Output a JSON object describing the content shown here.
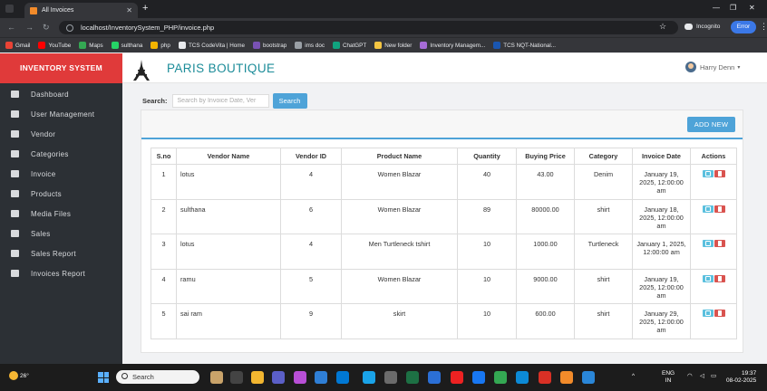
{
  "browser": {
    "tab_title": "All Invoices",
    "url": "localhost/InventorySystem_PHP/invoice.php",
    "incognito_label": "Incognito",
    "error_label": "Error",
    "bookmarks": [
      {
        "label": "Gmail",
        "color": "#ea4335"
      },
      {
        "label": "YouTube",
        "color": "#ff0000"
      },
      {
        "label": "Maps",
        "color": "#34a853"
      },
      {
        "label": "sulthana",
        "color": "#25d366"
      },
      {
        "label": "php",
        "color": "#f4b400"
      },
      {
        "label": "TCS CodeVita | Home",
        "color": "#e8eaed"
      },
      {
        "label": "bootstrap",
        "color": "#7952b3"
      },
      {
        "label": "ims doc",
        "color": "#9aa0a6"
      },
      {
        "label": "ChatGPT",
        "color": "#10a37f"
      },
      {
        "label": "New folder",
        "color": "#f4c542"
      },
      {
        "label": "Inventory Managem...",
        "color": "#a66cd6"
      },
      {
        "label": "TCS NQT-National...",
        "color": "#1a56b0"
      }
    ]
  },
  "sidebar": {
    "brand": "INVENTORY SYSTEM",
    "items": [
      {
        "label": "Dashboard",
        "icon": "home-icon"
      },
      {
        "label": "User Management",
        "icon": "user-icon"
      },
      {
        "label": "Vendor",
        "icon": "truck-icon"
      },
      {
        "label": "Categories",
        "icon": "list-icon"
      },
      {
        "label": "Invoice",
        "icon": "cart-icon"
      },
      {
        "label": "Products",
        "icon": "grid-icon"
      },
      {
        "label": "Media Files",
        "icon": "image-icon"
      },
      {
        "label": "Sales",
        "icon": "stack-icon"
      },
      {
        "label": "Sales Report",
        "icon": "chart-icon"
      },
      {
        "label": "Invoices Report",
        "icon": "report-icon"
      }
    ]
  },
  "header": {
    "store_name": "PARIS BOUTIQUE",
    "user_name": "Harry Denn"
  },
  "search": {
    "label": "Search:",
    "placeholder": "Search by Invoice Date, Ver",
    "button": "Search"
  },
  "panel": {
    "add_new": "ADD NEW"
  },
  "table": {
    "columns": [
      "S.no",
      "Vendor Name",
      "Vendor ID",
      "Product Name",
      "Quantity",
      "Buying Price",
      "Category",
      "Invoice Date",
      "Actions"
    ],
    "rows": [
      {
        "sno": "1",
        "vendor": "lotus",
        "vendor_id": "4",
        "product": "Women Blazar",
        "qty": "40",
        "price": "43.00",
        "category": "Denim",
        "date": "January 19, 2025, 12:00:00 am"
      },
      {
        "sno": "2",
        "vendor": "sulthana",
        "vendor_id": "6",
        "product": "Women Blazar",
        "qty": "89",
        "price": "80000.00",
        "category": "shirt",
        "date": "January 18, 2025, 12:00:00 am"
      },
      {
        "sno": "3",
        "vendor": "lotus",
        "vendor_id": "4",
        "product": "Men Turtleneck tshirt",
        "qty": "10",
        "price": "1000.00",
        "category": "Turtleneck",
        "date": "January 1, 2025, 12:00:00 am"
      },
      {
        "sno": "4",
        "vendor": "ramu",
        "vendor_id": "5",
        "product": "Women Blazar",
        "qty": "10",
        "price": "9000.00",
        "category": "shirt",
        "date": "January 19, 2025, 12:00:00 am"
      },
      {
        "sno": "5",
        "vendor": "sai ram",
        "vendor_id": "9",
        "product": "skirt",
        "qty": "10",
        "price": "600.00",
        "category": "shirt",
        "date": "January 29, 2025, 12:00:00 am"
      }
    ]
  },
  "taskbar": {
    "temperature": "26°",
    "search_label": "Search",
    "lang": "ENG",
    "region": "IN",
    "time": "19:37",
    "date": "08-02-2025"
  }
}
